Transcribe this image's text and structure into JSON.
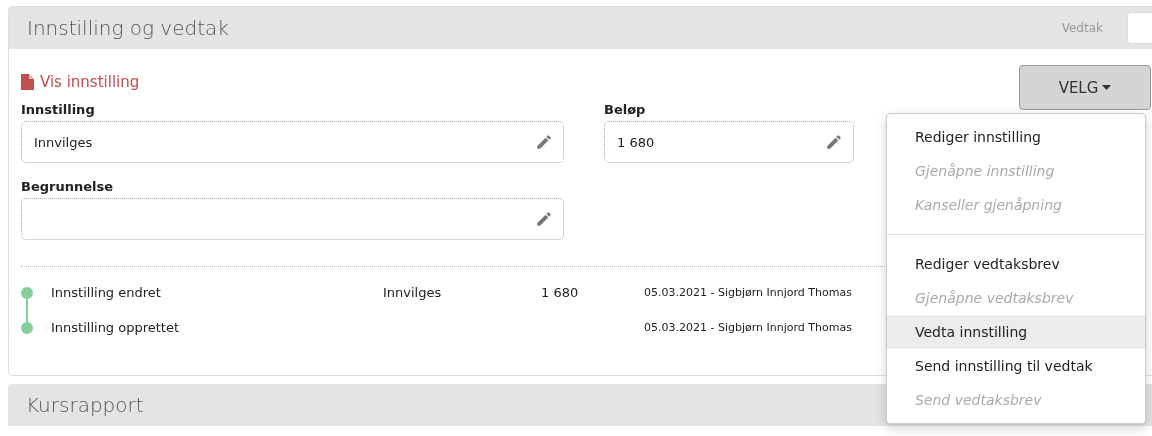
{
  "panel": {
    "title": "Innstilling og vedtak",
    "header_label": "Vedtak",
    "link": "Vis innstilling",
    "menu_button": "VELG",
    "fields": [
      {
        "label": "Innstilling",
        "value": "Innvilges"
      },
      {
        "label": "Beløp",
        "value": "1 680"
      },
      {
        "label": "Begrunnelse"
      }
    ],
    "history": [
      {
        "event": "Innstilling endret",
        "decision": "Innvilges",
        "amount": "1 680",
        "meta": "05.03.2021 - Sigbjørn Innjord Thomas"
      },
      {
        "event": "Innstilling opprettet",
        "meta": "05.03.2021 - Sigbjørn Innjord Thomas"
      }
    ]
  },
  "menu": {
    "groups": [
      [
        {
          "label": "Rediger innstilling",
          "disabled": false,
          "highlighted": false
        },
        {
          "label": "Gjenåpne innstilling",
          "disabled": true,
          "highlighted": false
        },
        {
          "label": "Kanseller gjenåpning",
          "disabled": true,
          "highlighted": false
        }
      ],
      [
        {
          "label": "Rediger vedtaksbrev",
          "disabled": false,
          "highlighted": false
        },
        {
          "label": "Gjenåpne vedtaksbrev",
          "disabled": true,
          "highlighted": false
        },
        {
          "label": "Vedta innstilling",
          "disabled": false,
          "highlighted": true
        },
        {
          "label": "Send innstilling til vedtak",
          "disabled": false,
          "highlighted": false
        },
        {
          "label": "Send vedtaksbrev",
          "disabled": true,
          "highlighted": false
        }
      ]
    ]
  },
  "next_panel": {
    "title": "Kursrapport"
  }
}
